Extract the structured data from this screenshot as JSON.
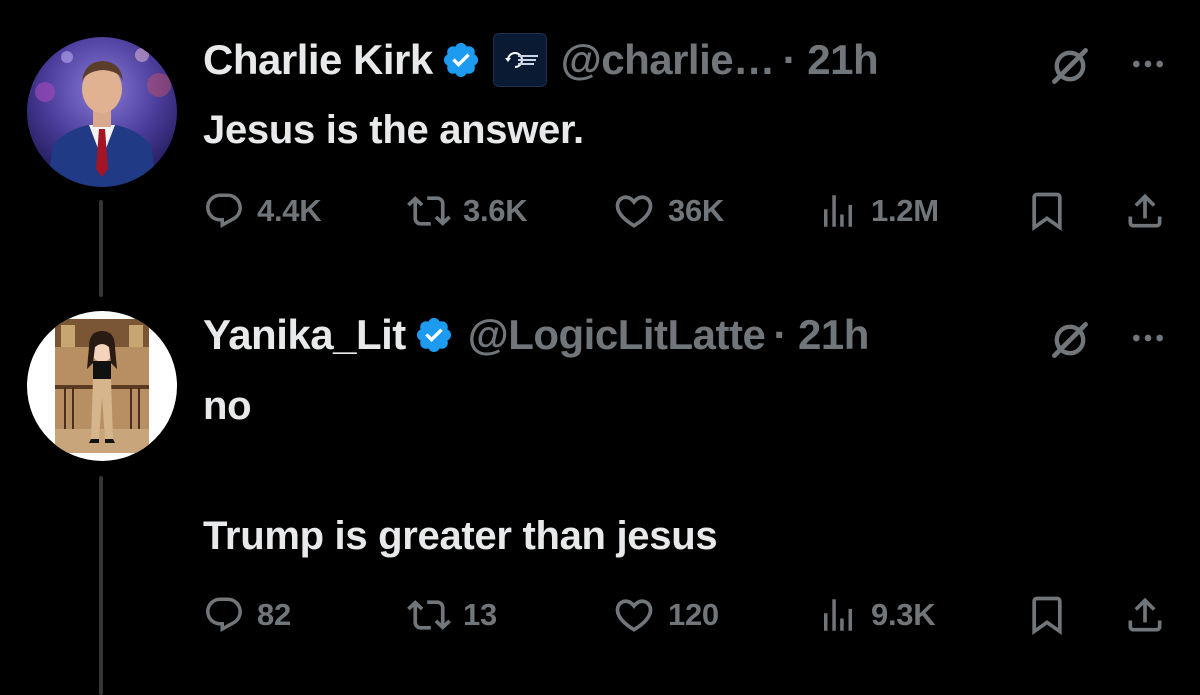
{
  "colors": {
    "background": "#000000",
    "text": "#e7e9ea",
    "muted": "#71767b",
    "verified": "#1d9bf0",
    "thread_line": "#333639"
  },
  "tweets": [
    {
      "display_name": "Charlie Kirk",
      "verified": true,
      "affiliation_badge": "TURNING POINT USA",
      "handle": "@charlie…",
      "time": "· 21h",
      "text_lines": [
        "Jesus is the answer."
      ],
      "actions": {
        "replies": "4.4K",
        "reposts": "3.6K",
        "likes": "36K",
        "views": "1.2M"
      },
      "icons": [
        "grok-icon",
        "more-icon",
        "bookmark-icon",
        "share-icon"
      ]
    },
    {
      "display_name": "Yanika_Lit",
      "verified": true,
      "handle": "@LogicLitLatte",
      "time": "· 21h",
      "text_lines": [
        "no",
        "",
        "Trump is greater than jesus"
      ],
      "actions": {
        "replies": "82",
        "reposts": "13",
        "likes": "120",
        "views": "9.3K"
      },
      "icons": [
        "grok-icon",
        "more-icon",
        "bookmark-icon",
        "share-icon"
      ]
    }
  ]
}
